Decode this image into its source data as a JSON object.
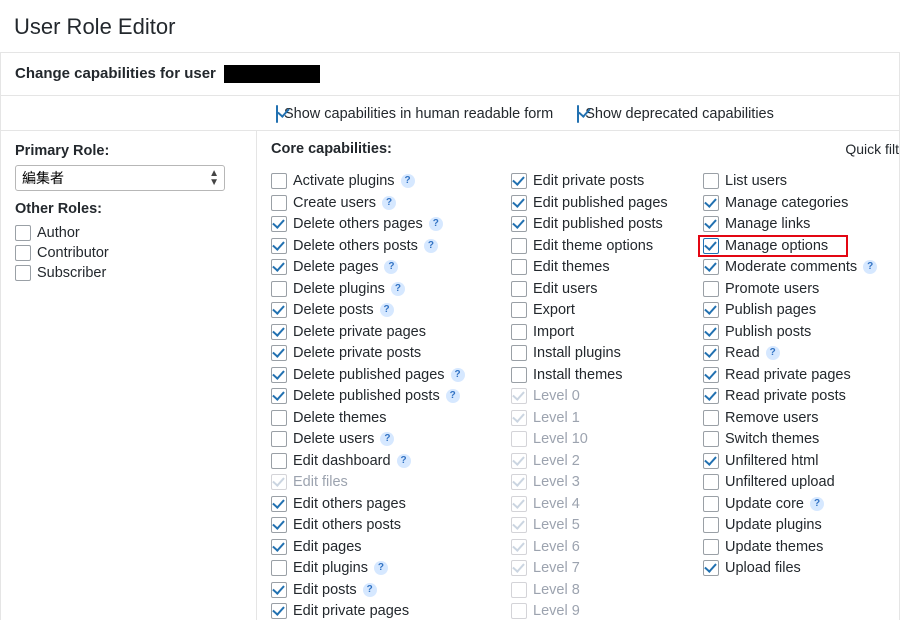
{
  "title": "User Role Editor",
  "subtitle_prefix": "Change capabilities for user",
  "top": {
    "human_label": "Show capabilities in human readable form",
    "human_checked": true,
    "deprecated_label": "Show deprecated capabilities",
    "deprecated_checked": true
  },
  "side": {
    "primary_h": "Primary Role:",
    "primary_value": "編集者",
    "other_h": "Other Roles:",
    "other_roles": [
      {
        "label": "Author",
        "checked": false
      },
      {
        "label": "Contributor",
        "checked": false
      },
      {
        "label": "Subscriber",
        "checked": false
      }
    ]
  },
  "main": {
    "heading": "Core capabilities:",
    "quick": "Quick filt"
  },
  "col1": [
    {
      "label": "Activate plugins",
      "checked": false,
      "help": true
    },
    {
      "label": "Create users",
      "checked": false,
      "help": true
    },
    {
      "label": "Delete others pages",
      "checked": true,
      "help": true
    },
    {
      "label": "Delete others posts",
      "checked": true,
      "help": true
    },
    {
      "label": "Delete pages",
      "checked": true,
      "help": true
    },
    {
      "label": "Delete plugins",
      "checked": false,
      "help": true
    },
    {
      "label": "Delete posts",
      "checked": true,
      "help": true
    },
    {
      "label": "Delete private pages",
      "checked": true
    },
    {
      "label": "Delete private posts",
      "checked": true
    },
    {
      "label": "Delete published pages",
      "checked": true,
      "help": true
    },
    {
      "label": "Delete published posts",
      "checked": true,
      "help": true
    },
    {
      "label": "Delete themes",
      "checked": false
    },
    {
      "label": "Delete users",
      "checked": false,
      "help": true
    },
    {
      "label": "Edit dashboard",
      "checked": false,
      "help": true
    },
    {
      "label": "Edit files",
      "checked": true,
      "disabled": true
    },
    {
      "label": "Edit others pages",
      "checked": true
    },
    {
      "label": "Edit others posts",
      "checked": true
    },
    {
      "label": "Edit pages",
      "checked": true
    },
    {
      "label": "Edit plugins",
      "checked": false,
      "help": true
    },
    {
      "label": "Edit posts",
      "checked": true,
      "help": true
    },
    {
      "label": "Edit private pages",
      "checked": true
    }
  ],
  "col2": [
    {
      "label": "Edit private posts",
      "checked": true
    },
    {
      "label": "Edit published pages",
      "checked": true
    },
    {
      "label": "Edit published posts",
      "checked": true
    },
    {
      "label": "Edit theme options",
      "checked": false
    },
    {
      "label": "Edit themes",
      "checked": false
    },
    {
      "label": "Edit users",
      "checked": false
    },
    {
      "label": "Export",
      "checked": false
    },
    {
      "label": "Import",
      "checked": false
    },
    {
      "label": "Install plugins",
      "checked": false
    },
    {
      "label": "Install themes",
      "checked": false
    },
    {
      "label": "Level 0",
      "checked": true,
      "disabled": true
    },
    {
      "label": "Level 1",
      "checked": true,
      "disabled": true
    },
    {
      "label": "Level 10",
      "checked": false,
      "disabled": true
    },
    {
      "label": "Level 2",
      "checked": true,
      "disabled": true
    },
    {
      "label": "Level 3",
      "checked": true,
      "disabled": true
    },
    {
      "label": "Level 4",
      "checked": true,
      "disabled": true
    },
    {
      "label": "Level 5",
      "checked": true,
      "disabled": true
    },
    {
      "label": "Level 6",
      "checked": true,
      "disabled": true
    },
    {
      "label": "Level 7",
      "checked": true,
      "disabled": true
    },
    {
      "label": "Level 8",
      "checked": false,
      "disabled": true
    },
    {
      "label": "Level 9",
      "checked": false,
      "disabled": true
    }
  ],
  "col3": [
    {
      "label": "List users",
      "checked": false
    },
    {
      "label": "Manage categories",
      "checked": true
    },
    {
      "label": "Manage links",
      "checked": true
    },
    {
      "label": "Manage options",
      "checked": true,
      "highlight": true,
      "blue": true
    },
    {
      "label": "Moderate comments",
      "checked": true,
      "help": true
    },
    {
      "label": "Promote users",
      "checked": false
    },
    {
      "label": "Publish pages",
      "checked": true
    },
    {
      "label": "Publish posts",
      "checked": true
    },
    {
      "label": "Read",
      "checked": true,
      "help": true
    },
    {
      "label": "Read private pages",
      "checked": true
    },
    {
      "label": "Read private posts",
      "checked": true
    },
    {
      "label": "Remove users",
      "checked": false
    },
    {
      "label": "Switch themes",
      "checked": false
    },
    {
      "label": "Unfiltered html",
      "checked": true
    },
    {
      "label": "Unfiltered upload",
      "checked": false
    },
    {
      "label": "Update core",
      "checked": false,
      "help": true
    },
    {
      "label": "Update plugins",
      "checked": false
    },
    {
      "label": "Update themes",
      "checked": false
    },
    {
      "label": "Upload files",
      "checked": true
    }
  ]
}
